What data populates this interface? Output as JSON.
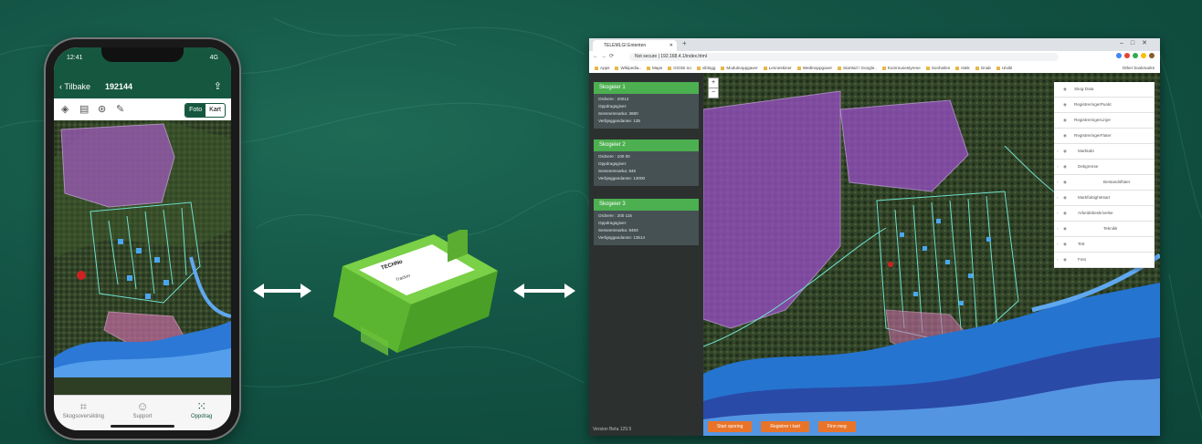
{
  "colors": {
    "brand_green": "#15573f",
    "accent_green": "#4caf50",
    "orange": "#e8742a",
    "sidebar": "#2c3130",
    "card": "#465154"
  },
  "phone": {
    "status_time": "12:41",
    "status_right": "4G",
    "back_label": "Tilbake",
    "title": "192144",
    "toggle": {
      "options": [
        "Foto",
        "Kart"
      ],
      "selected": "Foto"
    },
    "tools": [
      "layers-icon",
      "truck-icon",
      "settings-icon",
      "pen-icon"
    ],
    "tabs": [
      {
        "label": "Skogsoversikting",
        "icon": "map-icon",
        "active": false
      },
      {
        "label": "Support",
        "icon": "support-icon",
        "active": false
      },
      {
        "label": "Oppdrag",
        "icon": "grid-icon",
        "active": true
      }
    ]
  },
  "device": {
    "label": "TECHNo",
    "sub_label": "Tracker"
  },
  "browser": {
    "tab_title": "TELEMLGI Ententen",
    "url": "Not secure | 192.168.4.1/index.html",
    "bookmarks": [
      "Apps",
      "Wikipedia..",
      "Maps",
      "GOSE.no",
      "viblogg",
      "Modulnoppgaver",
      "Lenneskiner",
      "Wedtnoppgaver",
      "Startsid / Google..",
      "Kommunestyrene",
      "Sonheilen",
      "Islek",
      "Gnab",
      "Utvikl"
    ],
    "bookmarks_right": "Other bookmarks",
    "zoom": {
      "plus": "+",
      "minus": "−"
    },
    "cards": [
      {
        "title": "Skogeier 1",
        "lines": [
          "Ordnere : 20012",
          "Oppdragsgiver:",
          "Sensnemnarka: 3680",
          "Verbjeggandanse: 135"
        ]
      },
      {
        "title": "Skogeier 2",
        "lines": [
          "Ordnere : 100 00",
          "Oppdragsgiver:",
          "Sensnemnarka: 845",
          "Verbjeggandanse: 13000"
        ]
      },
      {
        "title": "Skogeier 3",
        "lines": [
          "Ordnere : 200 115",
          "Oppdragsgiver:",
          "Sensnemnarka: 8493",
          "Verbjeggandanse: 13514"
        ]
      }
    ],
    "version": "Version Beta 129.5",
    "layers": [
      {
        "label": "Skog Data",
        "type": "item"
      },
      {
        "label": "RegistreringerPunkt",
        "type": "item"
      },
      {
        "label": "RegistreringerLinjer",
        "type": "item"
      },
      {
        "label": "RegistreringerFlater",
        "type": "item"
      },
      {
        "label": "Marktabi",
        "type": "group"
      },
      {
        "label": "Dekgrense",
        "type": "group"
      },
      {
        "label": "Bestandsflater",
        "type": "center"
      },
      {
        "label": "Markfuktighetsart",
        "type": "group"
      },
      {
        "label": "Arbeidsbeskrivelse",
        "type": "group"
      },
      {
        "label": "Teknikk",
        "type": "center"
      },
      {
        "label": "Tett",
        "type": "group"
      },
      {
        "label": "Foto",
        "type": "group"
      }
    ],
    "buttons": [
      "Start sporing",
      "Registrer i kart",
      "Finn meg"
    ]
  }
}
